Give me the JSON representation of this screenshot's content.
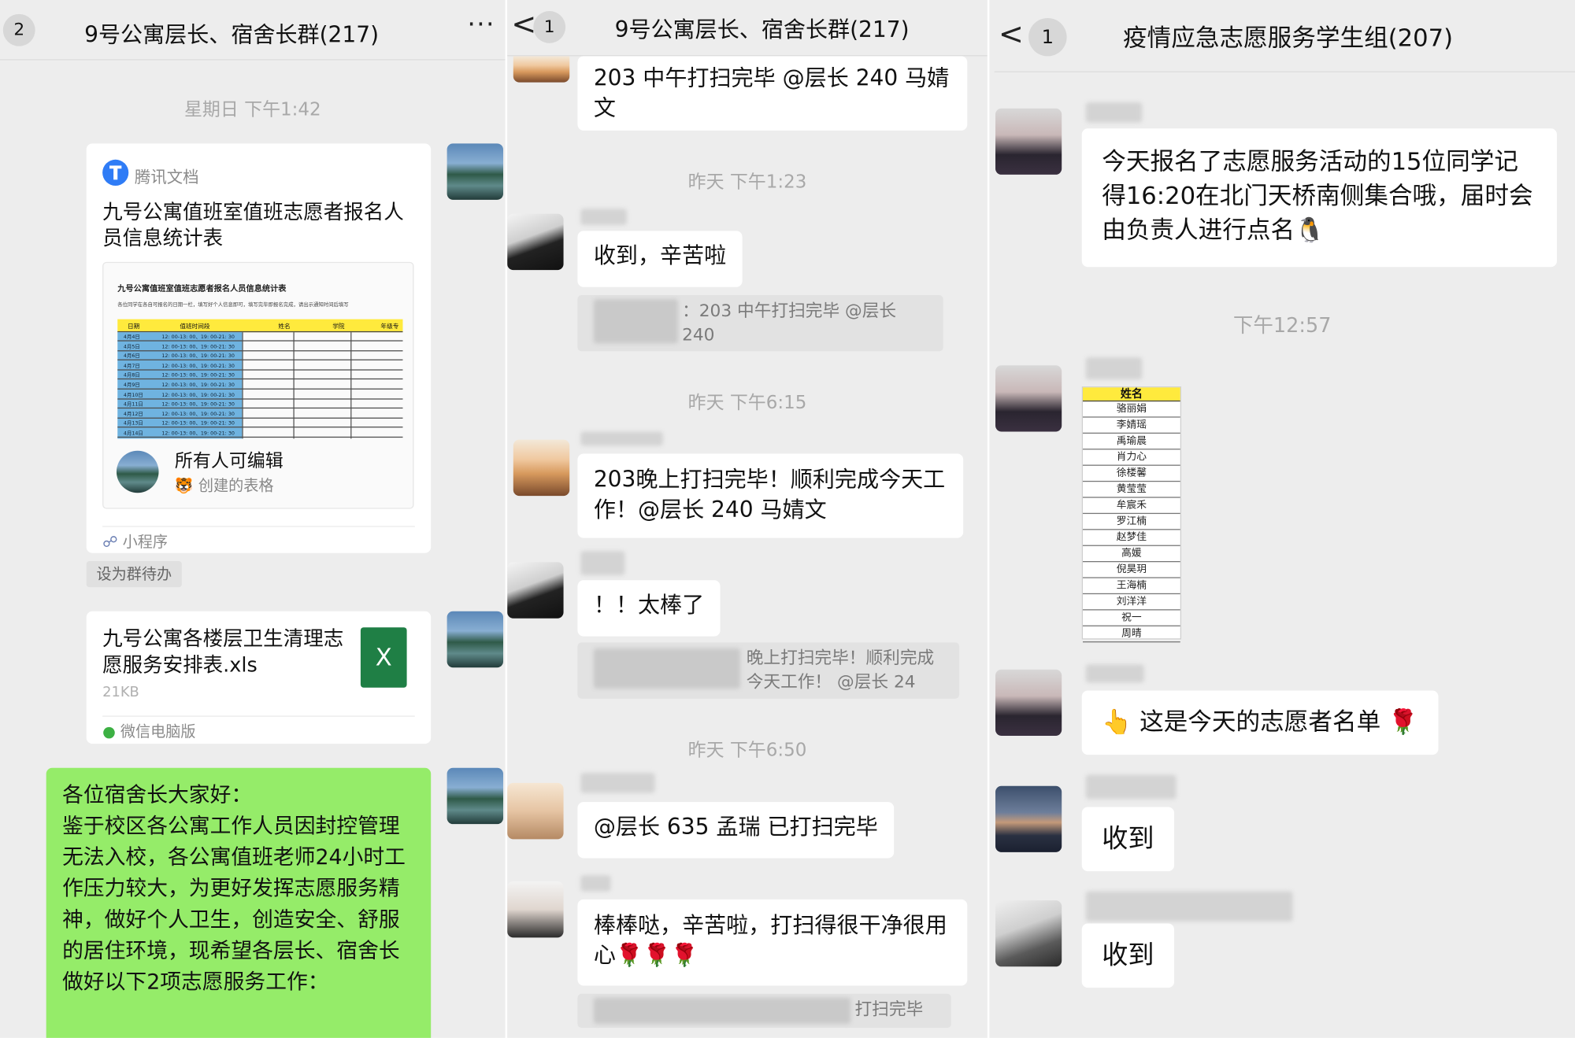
{
  "panel1": {
    "badge": "2",
    "title": "9号公寓层长、宿舍长群(217)",
    "more_label": "···",
    "time1": "星期日 下午1:42",
    "card1": {
      "app": "腾讯文档",
      "title": "九号公寓值班室值班志愿者报名人员信息统计表",
      "preview_title": "九号公寓值班室值班志愿者报名人员信息统计表",
      "preview_subtitle": "各位同学在各自可报名的日期一栏，填写好个人信息即可，填写完毕即报名完成，请出示通知时间后填写",
      "preview_headers": [
        "日期",
        "值班时间段",
        "姓名",
        "学院",
        "年级专"
      ],
      "preview_dates": [
        "4月4日",
        "4月5日",
        "4月6日",
        "4月7日",
        "4月8日",
        "4月9日",
        "4月10日",
        "4月11日",
        "4月12日",
        "4月13日",
        "4月14日"
      ],
      "preview_time": "12: 00-13: 00、19: 00-21: 30",
      "editable": "所有人可编辑",
      "created": "创建的表格",
      "footer": "小程序"
    },
    "set_todo": "设为群待办",
    "card2": {
      "filename": "九号公寓各楼层卫生清理志愿服务安排表.xls",
      "size": "21KB",
      "icon_letter": "X",
      "footer": "微信电脑版"
    },
    "notice": "各位宿舍长大家好：\n鉴于校区各公寓工作人员因封控管理无法入校，各公寓值班老师24小时工作压力较大，为更好发挥志愿服务精神，做好个人卫生，创造安全、舒服的居住环境，现希望各层长、宿舍长做好以下2项志愿服务工作："
  },
  "panel2": {
    "back": "<",
    "badge": "1",
    "title": "9号公寓层长、宿舍长群(217)",
    "msg0": "203 中午打扫完毕 @层长 240 马婧文",
    "time1": "昨天 下午1:23",
    "msg1": "收到，辛苦啦",
    "quote1": "：203 中午打扫完毕 @层长 240",
    "time2": "昨天 下午6:15",
    "msg2": "203晚上打扫完毕！顺利完成今天工作！@层长 240 马婧文",
    "msg3": "！！太棒了",
    "quote3": "晚上打扫完毕！顺利完成今天工作！ @层长 24",
    "time3": "昨天 下午6:50",
    "msg4": "@层长 635 孟瑞 已打扫完毕",
    "msg5": "棒棒哒，辛苦啦，打扫得很干净很用心🌹🌹🌹",
    "quote5": "打扫完毕"
  },
  "panel3": {
    "back": "<",
    "badge": "1",
    "title": "疫情应急志愿服务学生组(207)",
    "msg1": "今天报名了志愿服务活动的15位同学记得16:20在北门天桥南侧集合哦，届时会由负责人进行点名🐧",
    "time1": "下午12:57",
    "sheet_header": "姓名",
    "names": [
      "骆丽娟",
      "李婧瑶",
      "禹瑜晨",
      "肖力心",
      "徐楼馨",
      "黄莹莹",
      "牟宸禾",
      "罗江楠",
      "赵梦佳",
      "高媛",
      "倪昊玥",
      "王海楠",
      "刘洋洋",
      "祝一",
      "周晴"
    ],
    "msg2": "👆 这是今天的志愿者名单 🌹",
    "msg3": "收到",
    "msg4": "收到"
  }
}
